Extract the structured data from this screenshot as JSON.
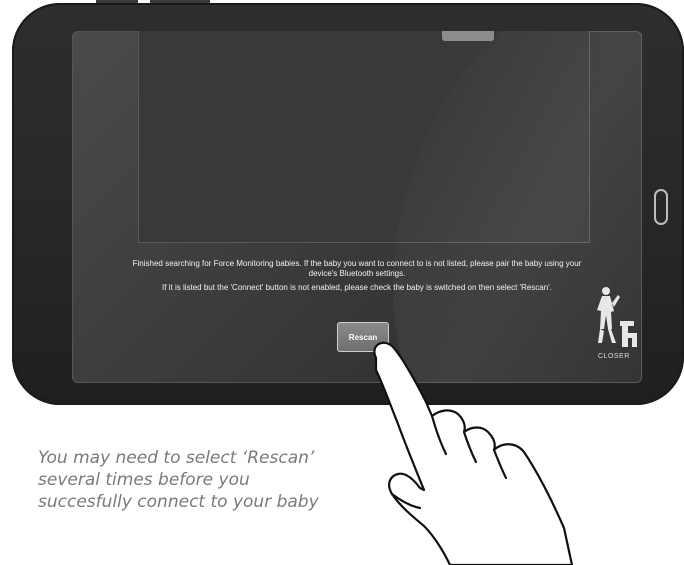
{
  "screen": {
    "message_line1": "Finished searching for Force Monitoring babies. If the baby you want to connect to is not listed, please pair the baby using your",
    "message_line1b": "device's Bluetooth settings.",
    "message_line2": "If it is listed but the 'Connect' button is not enabled, please check the baby is switched on then select 'Rescan'.",
    "rescan_label": "Rescan",
    "logo_text": "CLOSER",
    "logo_icon": "statue-logo-icon"
  },
  "caption": {
    "line1": "You may need to select ‘Rescan’",
    "line2": "several times before you",
    "line3": "succesfully connect to your baby"
  },
  "colors": {
    "bezel": "#2a2a2a",
    "screen": "#3c3c3c",
    "button": "#7d7d7d",
    "caption": "#7a7a7a"
  },
  "icons": {
    "pointer": "pointing-hand-icon",
    "home": "home-button-icon"
  }
}
